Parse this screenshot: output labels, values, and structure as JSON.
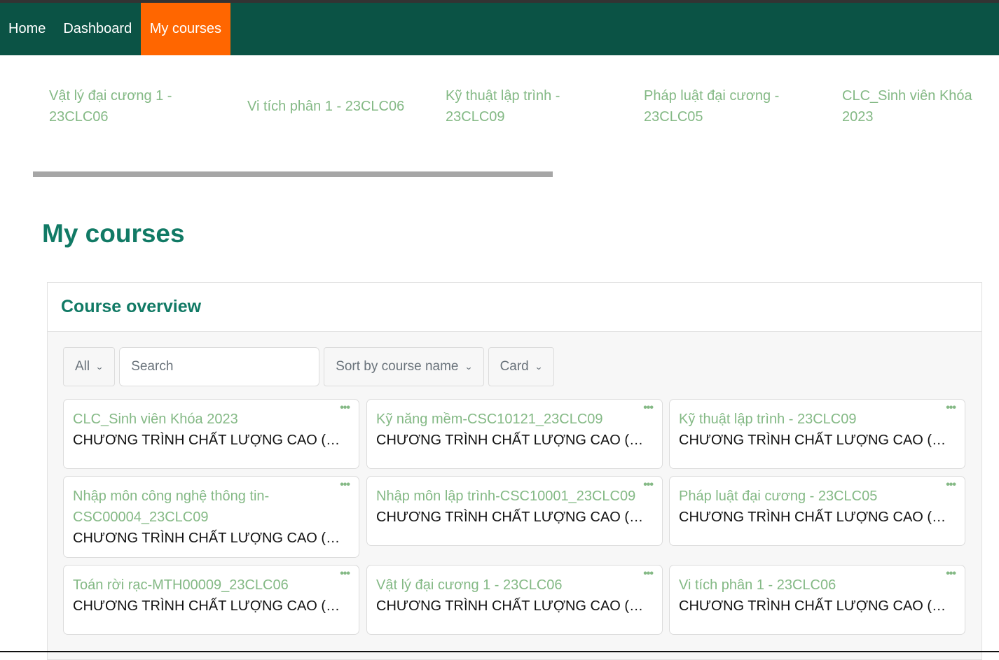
{
  "nav": {
    "items": [
      {
        "label": "Home",
        "active": false
      },
      {
        "label": "Dashboard",
        "active": false
      },
      {
        "label": "My courses",
        "active": true
      }
    ]
  },
  "carousel": {
    "items": [
      {
        "label": "Vật lý đại cương 1 - 23CLC06"
      },
      {
        "label": "Vi tích phân 1 - 23CLC06"
      },
      {
        "label": "Kỹ thuật lập trình - 23CLC09"
      },
      {
        "label": "Pháp luật đại cương - 23CLC05"
      },
      {
        "label": "CLC_Sinh viên Khóa 2023"
      }
    ]
  },
  "page": {
    "title": "My courses"
  },
  "overview": {
    "title": "Course overview",
    "filters": {
      "grouping": "All",
      "search_placeholder": "Search",
      "sort": "Sort by course name",
      "view": "Card",
      "chevron_icon": "chevron-down-icon"
    },
    "courses": [
      {
        "name": "CLC_Sinh viên Khóa 2023",
        "category": "CHƯƠNG TRÌNH CHẤT LƯỢNG CAO (CLC)"
      },
      {
        "name": "Kỹ năng mềm-CSC10121_23CLC09",
        "category": "CHƯƠNG TRÌNH CHẤT LƯỢNG CAO (CLC)"
      },
      {
        "name": "Kỹ thuật lập trình - 23CLC09",
        "category": "CHƯƠNG TRÌNH CHẤT LƯỢNG CAO (CLC)"
      },
      {
        "name": "Nhập môn công nghệ thông tin-CSC00004_23CLC09",
        "category": "CHƯƠNG TRÌNH CHẤT LƯỢNG CAO (CLC)"
      },
      {
        "name": "Nhập môn lập trình-CSC10001_23CLC09",
        "category": "CHƯƠNG TRÌNH CHẤT LƯỢNG CAO (CLC)"
      },
      {
        "name": "Pháp luật đại cương - 23CLC05",
        "category": "CHƯƠNG TRÌNH CHẤT LƯỢNG CAO (CLC)"
      },
      {
        "name": "Toán rời rạc-MTH00009_23CLC06",
        "category": "CHƯƠNG TRÌNH CHẤT LƯỢNG CAO (CLC)"
      },
      {
        "name": "Vật lý đại cương 1 - 23CLC06",
        "category": "CHƯƠNG TRÌNH CHẤT LƯỢNG CAO (CLC)"
      },
      {
        "name": "Vi tích phân 1 - 23CLC06",
        "category": "CHƯƠNG TRÌNH CHẤT LƯỢNG CAO (CLC)"
      }
    ],
    "card_menu_icon": "more-horizontal-icon",
    "card_menu_glyph": "•••"
  },
  "colors": {
    "navbar": "#0b5345",
    "nav_active": "#ff6600",
    "title": "#117a65",
    "course_link": "#84b985"
  }
}
